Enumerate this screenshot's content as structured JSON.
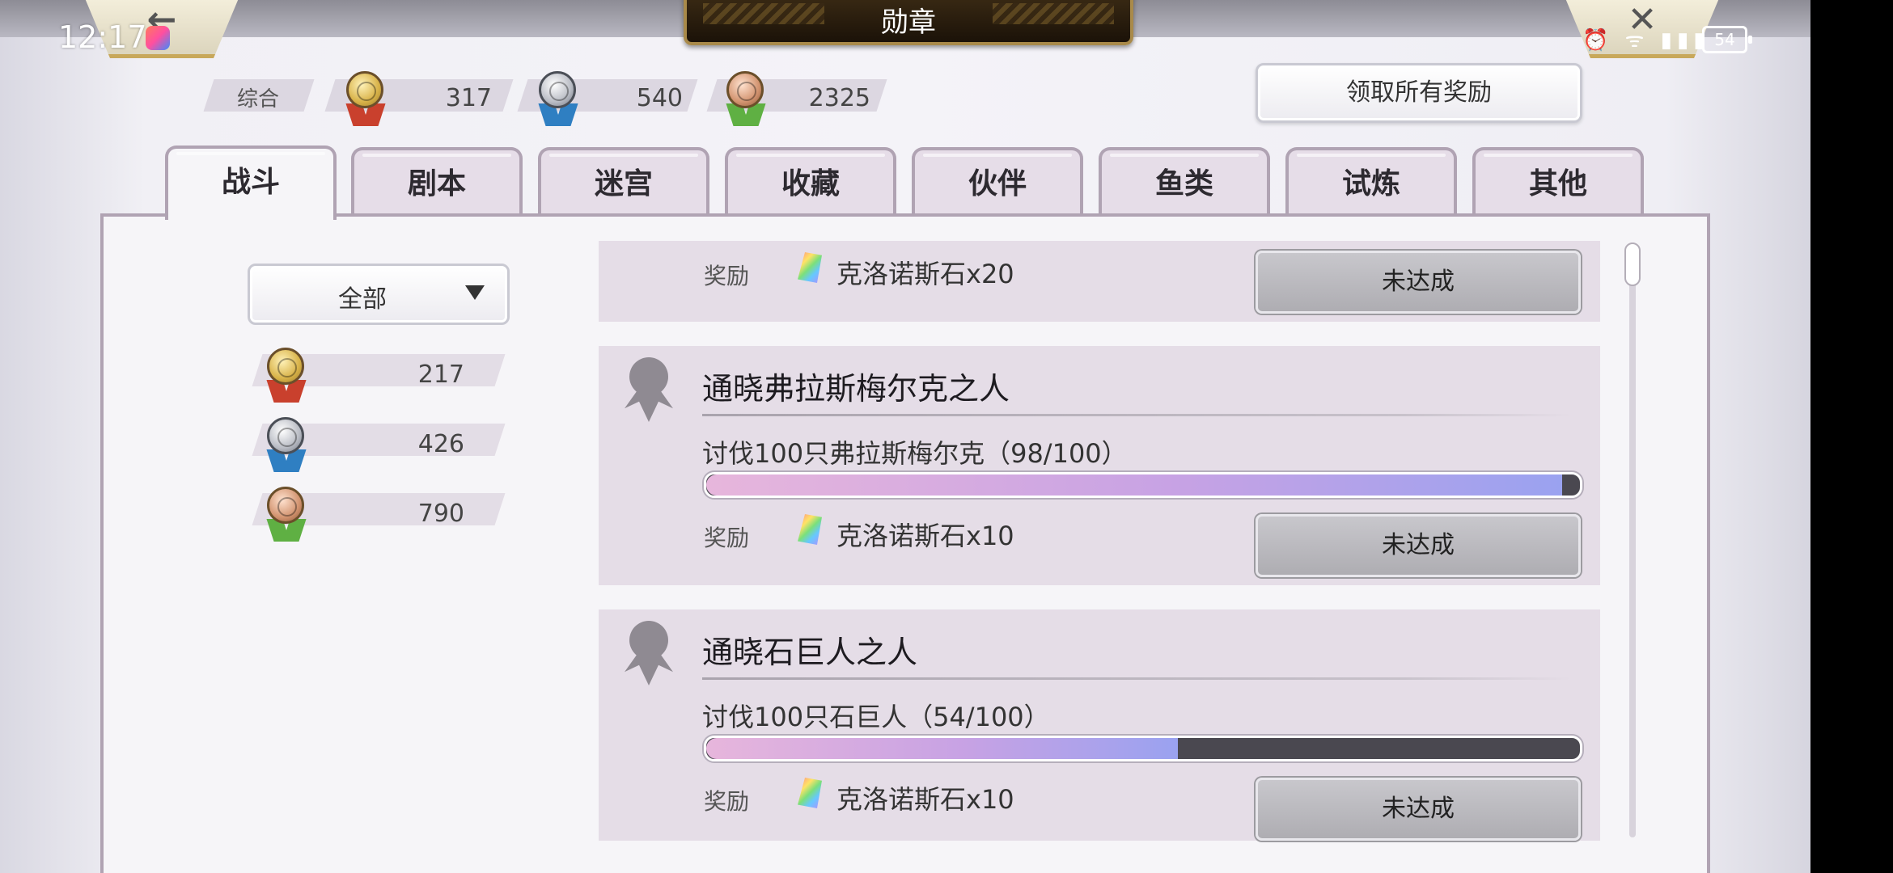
{
  "status_bar": {
    "time": "12:17",
    "icons": "⏰ ᯤ ▮▮▮",
    "battery": "54"
  },
  "header": {
    "title": "勋章",
    "back_glyph": "←",
    "close_glyph": "✕"
  },
  "summary": {
    "label": "综合",
    "gold": "317",
    "silver": "540",
    "bronze": "2325"
  },
  "claim_all_label": "领取所有奖励",
  "tabs": [
    "战斗",
    "剧本",
    "迷宫",
    "收藏",
    "伙伴",
    "鱼类",
    "试炼",
    "其他"
  ],
  "active_tab": "战斗",
  "filter": {
    "selected": "全部"
  },
  "category_counts": {
    "gold": "217",
    "silver": "426",
    "bronze": "790"
  },
  "reward_label": "奖励",
  "items": [
    {
      "reward": "克洛诺斯石x20",
      "status": "未达成"
    },
    {
      "title": "通晓弗拉斯梅尔克之人",
      "desc": "讨伐100只弗拉斯梅尔克（98/100）",
      "progress": 0.98,
      "reward": "克洛诺斯石x10",
      "status": "未达成"
    },
    {
      "title": "通晓石巨人之人",
      "desc": "讨伐100只石巨人（54/100）",
      "progress": 0.54,
      "reward": "克洛诺斯石x10",
      "status": "未达成"
    }
  ],
  "colors": {
    "gold_ribbon": "#c9402d",
    "silver_ribbon": "#2f7fc2",
    "bronze_ribbon": "#5fb043",
    "panel": "#f6f5f8",
    "item_bg": "#e5dde7"
  }
}
